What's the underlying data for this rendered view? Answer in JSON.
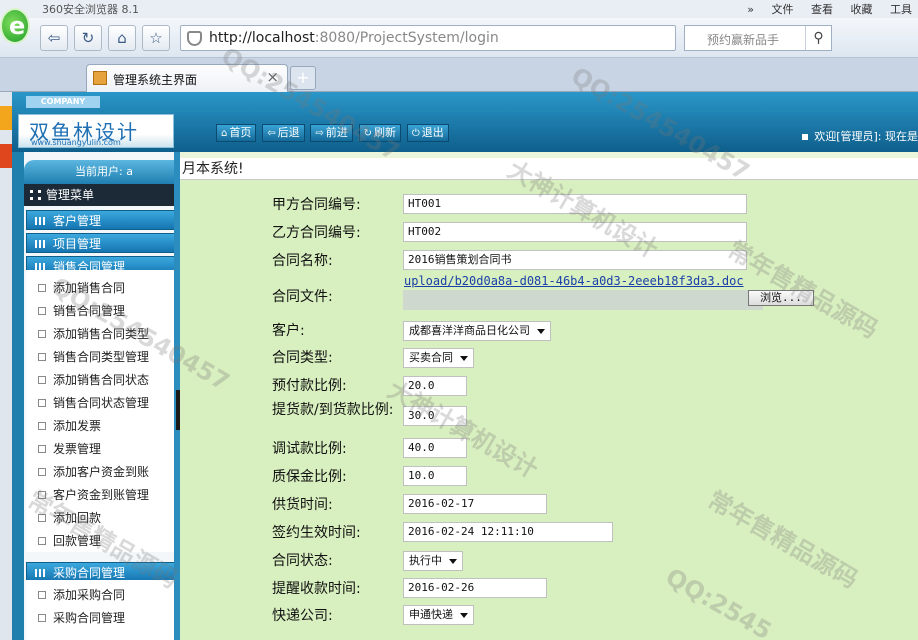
{
  "browser": {
    "title": "360安全浏览器 8.1",
    "menus": [
      "»",
      "文件",
      "查看",
      "收藏",
      "工具"
    ],
    "url_host": "http://localhost",
    "url_rest": ":8080/ProjectSystem/login",
    "search_placeholder": "预约赢新品手",
    "tab_title": "管理系统主界面",
    "tab_close": "×",
    "new_tab": "+"
  },
  "header": {
    "company": "COMPANY",
    "brand": "双鱼林设计",
    "brand_url": "www.shuangyulin.com",
    "toolbar": [
      {
        "icon": "home-icon",
        "glyph": "⌂",
        "label": "首页"
      },
      {
        "icon": "arrow-left-icon",
        "glyph": "⇦",
        "label": "后退"
      },
      {
        "icon": "arrow-right-icon",
        "glyph": "⇨",
        "label": "前进"
      },
      {
        "icon": "refresh-icon",
        "glyph": "↻",
        "label": "刷新"
      },
      {
        "icon": "power-icon",
        "glyph": "⏻",
        "label": "退出"
      }
    ],
    "welcome": "欢迎[管理员]: 现在是"
  },
  "sidebar": {
    "current_user": "当前用户: a",
    "menu_title": "管理菜单",
    "groups": [
      {
        "label": "客户管理",
        "items": []
      },
      {
        "label": "项目管理",
        "items": []
      },
      {
        "label": "销售合同管理",
        "items": [
          "添加销售合同",
          "销售合同管理",
          "添加销售合同类型",
          "销售合同类型管理",
          "添加销售合同状态",
          "销售合同状态管理",
          "添加发票",
          "发票管理",
          "添加客户资金到账",
          "客户资金到账管理",
          "添加回款",
          "回款管理"
        ]
      },
      {
        "label": "采购合同管理",
        "items": [
          "添加采购合同",
          "采购合同管理"
        ]
      }
    ]
  },
  "main": {
    "heading": "月本系统!",
    "fields": [
      {
        "label": "甲方合同编号:",
        "value": "HT001",
        "kind": "input"
      },
      {
        "label": "乙方合同编号:",
        "value": "HT002",
        "kind": "input"
      },
      {
        "label": "合同名称:",
        "value": "2016销售策划合同书",
        "kind": "input"
      },
      {
        "label": "合同文件:",
        "value": "upload/b20d0a8a-d081-46b4-a0d3-2eeeb18f3da3.doc",
        "kind": "file"
      },
      {
        "label": "客户:",
        "value": "成都喜洋洋商品日化公司",
        "kind": "select"
      },
      {
        "label": "合同类型:",
        "value": "买卖合同",
        "kind": "select"
      },
      {
        "label": "预付款比例:",
        "value": "20.0",
        "kind": "input"
      },
      {
        "label": "提货款/到货款比例:",
        "value": "30.0",
        "kind": "input"
      },
      {
        "label": "调试款比例:",
        "value": "40.0",
        "kind": "input"
      },
      {
        "label": "质保金比例:",
        "value": "10.0",
        "kind": "input"
      },
      {
        "label": "供货时间:",
        "value": "2016-02-17",
        "kind": "input"
      },
      {
        "label": "签约生效时间:",
        "value": "2016-02-24 12:11:10",
        "kind": "input"
      },
      {
        "label": "合同状态:",
        "value": "执行中",
        "kind": "select"
      },
      {
        "label": "提醒收款时间:",
        "value": "2016-02-26",
        "kind": "input"
      },
      {
        "label": "快递公司:",
        "value": "申通快递",
        "kind": "select"
      }
    ],
    "browse_label": "浏览..."
  },
  "watermarks": [
    "QQ:254540457",
    "大神计算机设计",
    "常年售精品源码",
    "QQ:254540457",
    "大神计算机设计",
    "常年售精品源码",
    "QQ:2545",
    "QQ:254540457",
    "常年售精品源码"
  ]
}
